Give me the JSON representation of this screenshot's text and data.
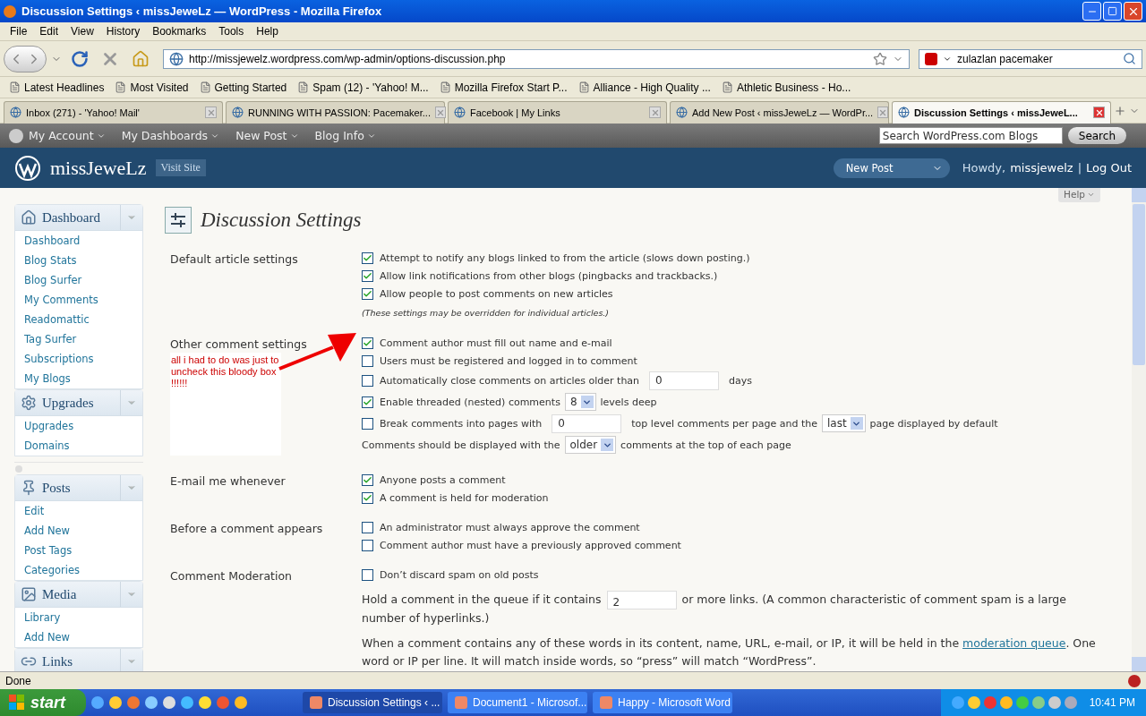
{
  "window": {
    "title": "Discussion Settings ‹ missJeweLz — WordPress - Mozilla Firefox"
  },
  "menu": [
    "File",
    "Edit",
    "View",
    "History",
    "Bookmarks",
    "Tools",
    "Help"
  ],
  "toolbar": {
    "url": "http://missjewelz.wordpress.com/wp-admin/options-discussion.php",
    "search_value": "zulazlan pacemaker"
  },
  "bookmarks": [
    "Latest Headlines",
    "Most Visited",
    "Getting Started",
    "Spam (12) - 'Yahoo! M...",
    "Mozilla Firefox Start P...",
    "Alliance - High Quality ...",
    "Athletic Business - Ho..."
  ],
  "tabs": [
    {
      "label": "Inbox (271) - 'Yahoo! Mail'",
      "selected": false
    },
    {
      "label": "RUNNING WITH PASSION: Pacemaker...",
      "selected": false
    },
    {
      "label": "Facebook | My Links",
      "selected": false
    },
    {
      "label": "Add New Post ‹ missJeweLz — WordPr...",
      "selected": false
    },
    {
      "label": "Discussion Settings ‹ missJeweL...",
      "selected": true
    }
  ],
  "admin_bar": {
    "items": [
      "My Account",
      "My Dashboards",
      "New Post",
      "Blog Info"
    ],
    "search_placeholder": "Search WordPress.com Blogs",
    "search_button": "Search"
  },
  "header": {
    "site_name": "missJeweLz",
    "visit_site": "Visit Site",
    "new_post": "New Post",
    "howdy": "Howdy,",
    "user": "missjewelz",
    "separator": "|",
    "logout": "Log Out"
  },
  "help": "Help",
  "sidebar": [
    {
      "title": "Dashboard",
      "items": [
        "Dashboard",
        "Blog Stats",
        "Blog Surfer",
        "My Comments",
        "Readomattic",
        "Tag Surfer",
        "Subscriptions",
        "My Blogs"
      ]
    },
    {
      "title": "Upgrades",
      "separator_after": true,
      "items": [
        "Upgrades",
        "Domains"
      ]
    },
    {
      "title": "Posts",
      "items": [
        "Edit",
        "Add New",
        "Post Tags",
        "Categories"
      ]
    },
    {
      "title": "Media",
      "items": [
        "Library",
        "Add New"
      ]
    },
    {
      "title": "Links"
    }
  ],
  "page_title": "Discussion Settings",
  "sections": [
    {
      "label": "Default article settings",
      "rows": [
        {
          "kind": "check",
          "checked": true,
          "parts": [
            {
              "kind": "text",
              "text": "Attempt to notify any blogs linked to from the article (slows down posting.)"
            }
          ]
        },
        {
          "kind": "check",
          "checked": true,
          "parts": [
            {
              "kind": "text",
              "text": "Allow link notifications from other blogs (pingbacks and trackbacks.)"
            }
          ]
        },
        {
          "kind": "check",
          "checked": true,
          "parts": [
            {
              "kind": "text",
              "text": "Allow people to post comments on new articles"
            }
          ]
        },
        {
          "kind": "note",
          "text": "(These settings may be overridden for individual articles.)"
        }
      ]
    },
    {
      "label": "Other comment settings",
      "annotation": "all i had to do was just to uncheck this bloody box !!!!!!",
      "rows": [
        {
          "kind": "check",
          "checked": true,
          "parts": [
            {
              "kind": "text",
              "text": "Comment author must fill out name and e-mail"
            }
          ]
        },
        {
          "kind": "check",
          "checked": false,
          "parts": [
            {
              "kind": "text",
              "text": "Users must be registered and logged in to comment"
            }
          ]
        },
        {
          "kind": "check",
          "checked": false,
          "parts": [
            {
              "kind": "text",
              "text": "Automatically close comments on articles older than"
            },
            {
              "kind": "input",
              "text": "0"
            },
            {
              "kind": "text",
              "text": "days"
            }
          ]
        },
        {
          "kind": "check",
          "checked": true,
          "parts": [
            {
              "kind": "text",
              "text": "Enable threaded (nested) comments"
            },
            {
              "kind": "select",
              "text": "8"
            },
            {
              "kind": "text",
              "text": "levels deep"
            }
          ]
        },
        {
          "kind": "check",
          "checked": false,
          "parts": [
            {
              "kind": "text",
              "text": "Break comments into pages with"
            },
            {
              "kind": "input",
              "text": "0"
            },
            {
              "kind": "text",
              "text": "top level comments per page and the"
            },
            {
              "kind": "select",
              "text": "last"
            },
            {
              "kind": "text",
              "text": "page displayed by default"
            }
          ]
        },
        {
          "kind": "plain",
          "parts": [
            {
              "kind": "text",
              "text": "Comments should be displayed with the"
            },
            {
              "kind": "select",
              "text": "older"
            },
            {
              "kind": "text",
              "text": "comments at the top of each page"
            }
          ]
        }
      ]
    },
    {
      "label": "E-mail me whenever",
      "rows": [
        {
          "kind": "check",
          "checked": true,
          "parts": [
            {
              "kind": "text",
              "text": "Anyone posts a comment"
            }
          ]
        },
        {
          "kind": "check",
          "checked": true,
          "parts": [
            {
              "kind": "text",
              "text": "A comment is held for moderation"
            }
          ]
        }
      ]
    },
    {
      "label": "Before a comment appears",
      "rows": [
        {
          "kind": "check",
          "checked": false,
          "parts": [
            {
              "kind": "text",
              "text": "An administrator must always approve the comment"
            }
          ]
        },
        {
          "kind": "check",
          "checked": false,
          "parts": [
            {
              "kind": "text",
              "text": "Comment author must have a previously approved comment"
            }
          ]
        }
      ]
    },
    {
      "label": "Comment Moderation",
      "rows": [
        {
          "kind": "check",
          "checked": false,
          "parts": [
            {
              "kind": "text",
              "text": "Don’t discard spam on old posts"
            }
          ]
        },
        {
          "kind": "paragraph",
          "parts": [
            {
              "kind": "text",
              "text": "Hold a comment in the queue if it contains"
            },
            {
              "kind": "input",
              "text": "2"
            },
            {
              "kind": "text",
              "text": "or more links. (A common characteristic of comment spam is a large number of hyperlinks.)"
            }
          ]
        },
        {
          "kind": "paragraph",
          "parts": [
            {
              "kind": "text",
              "text": "When a comment contains any of these words in its content, name, URL, e-mail, or IP, it will be held in the "
            },
            {
              "kind": "link",
              "text": "moderation queue"
            },
            {
              "kind": "text",
              "text": ". One word or IP per line. It will match inside words, so “press” will match “WordPress”."
            }
          ]
        }
      ]
    }
  ],
  "status": "Done",
  "taskbar": {
    "start": "start",
    "tasks": [
      {
        "label": "Discussion Settings ‹ ...",
        "selected": true
      },
      {
        "label": "Document1 - Microsof...",
        "selected": false
      },
      {
        "label": "Happy - Microsoft Word",
        "selected": false
      }
    ],
    "clock": "10:41 PM"
  }
}
